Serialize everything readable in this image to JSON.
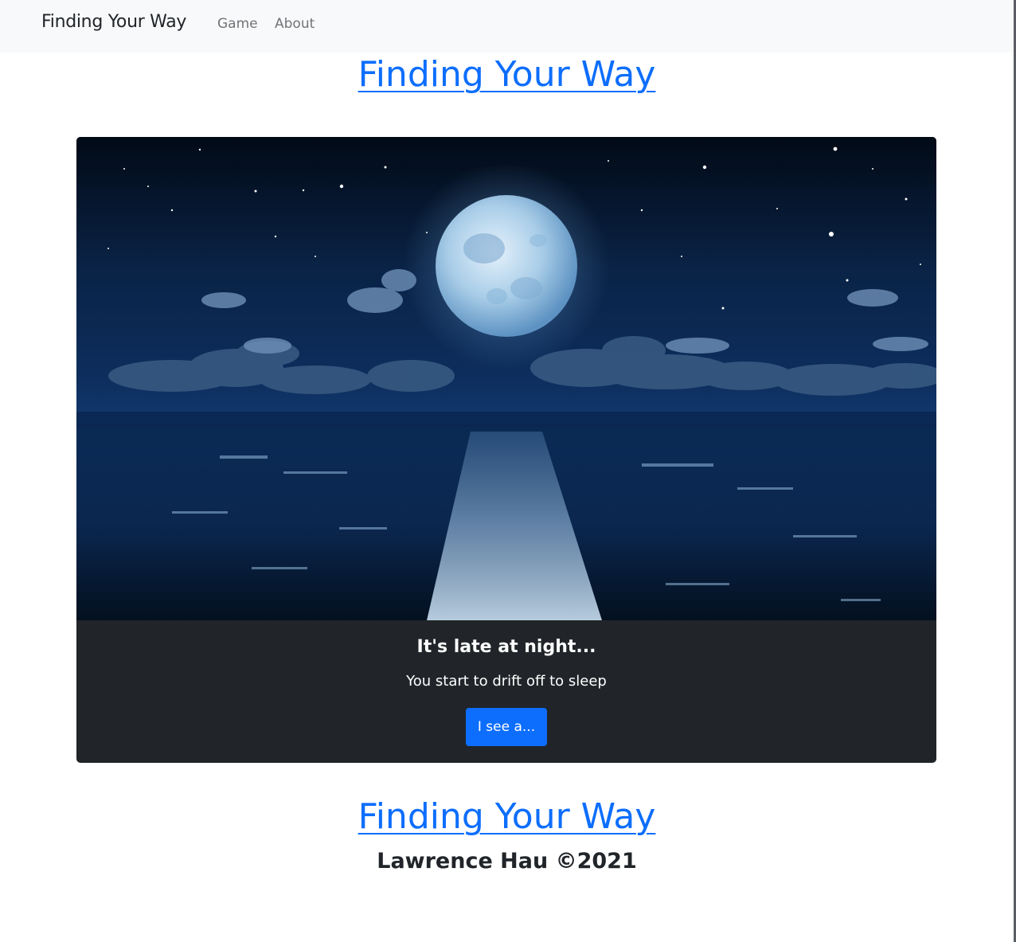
{
  "navbar": {
    "brand": "Finding Your Way",
    "links": [
      {
        "label": "Game"
      },
      {
        "label": "About"
      }
    ]
  },
  "header": {
    "title": "Finding Your Way"
  },
  "card": {
    "image": "moonlit-night-sea-image",
    "title": "It's late at night...",
    "text": "You start to drift off to sleep",
    "button_label": "I see a..."
  },
  "footer": {
    "title": "Finding Your Way",
    "credit": "Lawrence Hau ©2021"
  },
  "colors": {
    "link": "#0d6efd",
    "navbar_bg": "#f8f9fa",
    "card_body_bg": "#212529",
    "button_bg": "#0d6efd"
  }
}
